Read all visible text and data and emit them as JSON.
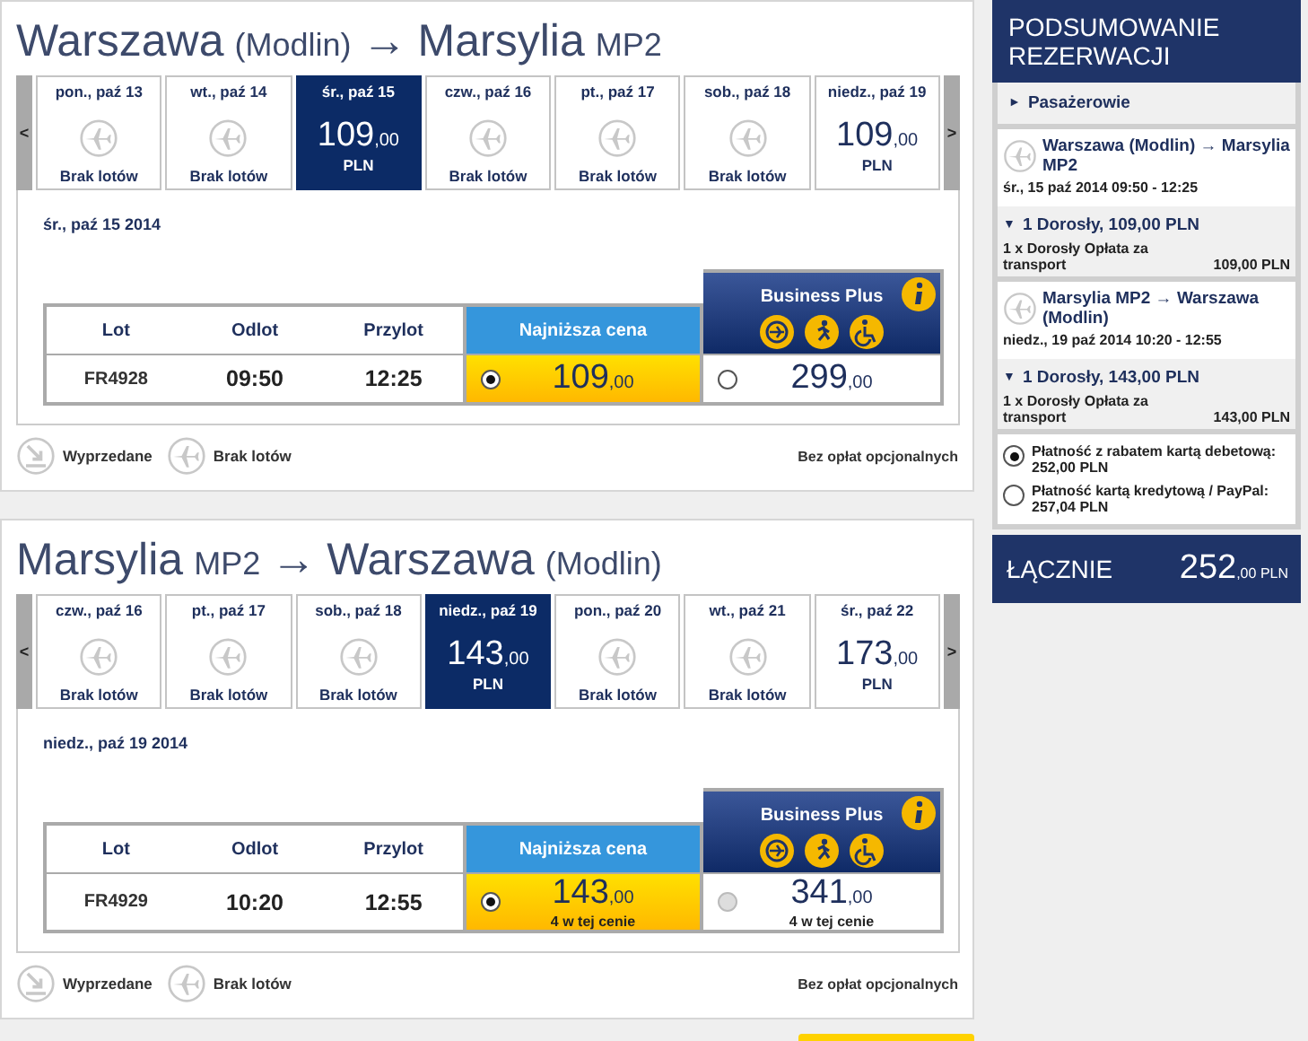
{
  "flights": [
    {
      "origin": {
        "city": "Warszawa",
        "airport": "(Modlin)"
      },
      "arrow": "→",
      "destination": {
        "city": "Marsylia",
        "airport": "MP2"
      },
      "prev": "<",
      "next": ">",
      "dates": [
        {
          "label": "pon., paź 13",
          "selected": false,
          "kind": "none",
          "status": "Brak lotów"
        },
        {
          "label": "wt., paź 14",
          "selected": false,
          "kind": "none",
          "status": "Brak lotów"
        },
        {
          "label": "śr., paź 15",
          "selected": true,
          "kind": "price",
          "price": "109",
          "decimals": ",00",
          "currency": "PLN"
        },
        {
          "label": "czw., paź 16",
          "selected": false,
          "kind": "none",
          "status": "Brak lotów"
        },
        {
          "label": "pt., paź 17",
          "selected": false,
          "kind": "none",
          "status": "Brak lotów"
        },
        {
          "label": "sob., paź 18",
          "selected": false,
          "kind": "none",
          "status": "Brak lotów"
        },
        {
          "label": "niedz., paź 19",
          "selected": false,
          "kind": "price",
          "price": "109",
          "decimals": ",00",
          "currency": "PLN"
        }
      ],
      "date_heading": "śr., paź 15 2014",
      "columns": [
        "Lot",
        "Odlot",
        "Przylot"
      ],
      "fare_columns": [
        {
          "kind": "lowest",
          "label": "Najniższa cena"
        },
        {
          "kind": "business",
          "label": "Business Plus"
        }
      ],
      "row": {
        "flight": "FR4928",
        "departure": "09:50",
        "arrival": "12:25",
        "fares": [
          {
            "selected": true,
            "disabled": false,
            "price": "109",
            "decimals": ",00"
          },
          {
            "selected": false,
            "disabled": false,
            "price": "299",
            "decimals": ",00"
          }
        ]
      },
      "legend": [
        "Wyprzedane",
        "Brak lotów"
      ],
      "note": "Bez opłat opcjonalnych"
    },
    {
      "origin": {
        "city": "Marsylia",
        "airport": "MP2"
      },
      "arrow": "→",
      "destination": {
        "city": "Warszawa",
        "airport": "(Modlin)"
      },
      "prev": "<",
      "next": ">",
      "dates": [
        {
          "label": "czw., paź 16",
          "selected": false,
          "kind": "none",
          "status": "Brak lotów"
        },
        {
          "label": "pt., paź 17",
          "selected": false,
          "kind": "none",
          "status": "Brak lotów"
        },
        {
          "label": "sob., paź 18",
          "selected": false,
          "kind": "none",
          "status": "Brak lotów"
        },
        {
          "label": "niedz., paź 19",
          "selected": true,
          "kind": "price",
          "price": "143",
          "decimals": ",00",
          "currency": "PLN"
        },
        {
          "label": "pon., paź 20",
          "selected": false,
          "kind": "none",
          "status": "Brak lotów"
        },
        {
          "label": "wt., paź 21",
          "selected": false,
          "kind": "none",
          "status": "Brak lotów"
        },
        {
          "label": "śr., paź 22",
          "selected": false,
          "kind": "price",
          "price": "173",
          "decimals": ",00",
          "currency": "PLN"
        }
      ],
      "date_heading": "niedz., paź 19 2014",
      "columns": [
        "Lot",
        "Odlot",
        "Przylot"
      ],
      "fare_columns": [
        {
          "kind": "lowest",
          "label": "Najniższa cena"
        },
        {
          "kind": "business",
          "label": "Business Plus"
        }
      ],
      "row": {
        "flight": "FR4929",
        "departure": "10:20",
        "arrival": "12:55",
        "fares": [
          {
            "selected": true,
            "disabled": false,
            "price": "143",
            "decimals": ",00",
            "note": "4 w tej cenie"
          },
          {
            "selected": false,
            "disabled": true,
            "price": "341",
            "decimals": ",00",
            "note": "4 w tej cenie"
          }
        ]
      },
      "legend": [
        "Wyprzedane",
        "Brak lotów"
      ],
      "note": "Bez opłat opcjonalnych"
    }
  ],
  "summary": {
    "title": "PODSUMOWANIE REZERWACJI",
    "passengers": {
      "label": "Pasażerowie",
      "marker": "►"
    },
    "segments": [
      {
        "route": "Warszawa (Modlin) → Marsylia MP2",
        "datetime": "śr., 15 paź 2014 09:50 - 12:25",
        "fare": "1 Dorosły, 109,00 PLN",
        "marker": "▼",
        "line": "1 x Dorosły Opłata za transport",
        "amount": "109,00 PLN"
      },
      {
        "route": "Marsylia MP2 → Warszawa (Modlin)",
        "datetime": "niedz., 19 paź 2014 10:20 - 12:55",
        "fare": "1 Dorosły, 143,00 PLN",
        "marker": "▼",
        "line": "1 x Dorosły Opłata za transport",
        "amount": "143,00 PLN"
      }
    ],
    "payments": [
      {
        "label": "Płatność z rabatem kartą debetową: 252,00 PLN",
        "selected": true
      },
      {
        "label": "Płatność kartą kredytową / PayPal: 257,04 PLN",
        "selected": false
      }
    ],
    "total": {
      "label": "ŁĄCZNIE",
      "amount": "252",
      "decimals": ",00",
      "currency": "PLN"
    }
  }
}
